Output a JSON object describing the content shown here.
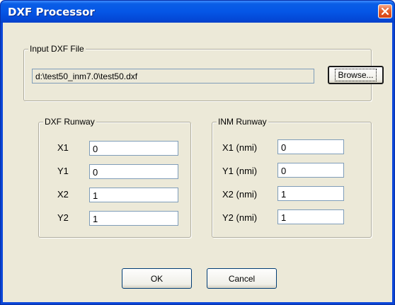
{
  "window": {
    "title": "DXF Processor",
    "close_icon": "close-icon"
  },
  "input_group": {
    "legend": "Input DXF File",
    "path_value": "d:\\test50_inm7.0\\test50.dxf",
    "browse_label": "Browse..."
  },
  "dxf_runway": {
    "legend": "DXF Runway",
    "rows": [
      {
        "label": "X1",
        "value": "0"
      },
      {
        "label": "Y1",
        "value": "0"
      },
      {
        "label": "X2",
        "value": "1"
      },
      {
        "label": "Y2",
        "value": "1"
      }
    ]
  },
  "inm_runway": {
    "legend": "INM Runway",
    "rows": [
      {
        "label": "X1 (nmi)",
        "value": "0"
      },
      {
        "label": "Y1 (nmi)",
        "value": "0"
      },
      {
        "label": "X2 (nmi)",
        "value": "1"
      },
      {
        "label": "Y2 (nmi)",
        "value": "1"
      }
    ]
  },
  "buttons": {
    "ok_label": "OK",
    "cancel_label": "Cancel"
  },
  "colors": {
    "titlebar": "#0556e6",
    "client_bg": "#ece9d8",
    "close_button": "#e4602c"
  }
}
